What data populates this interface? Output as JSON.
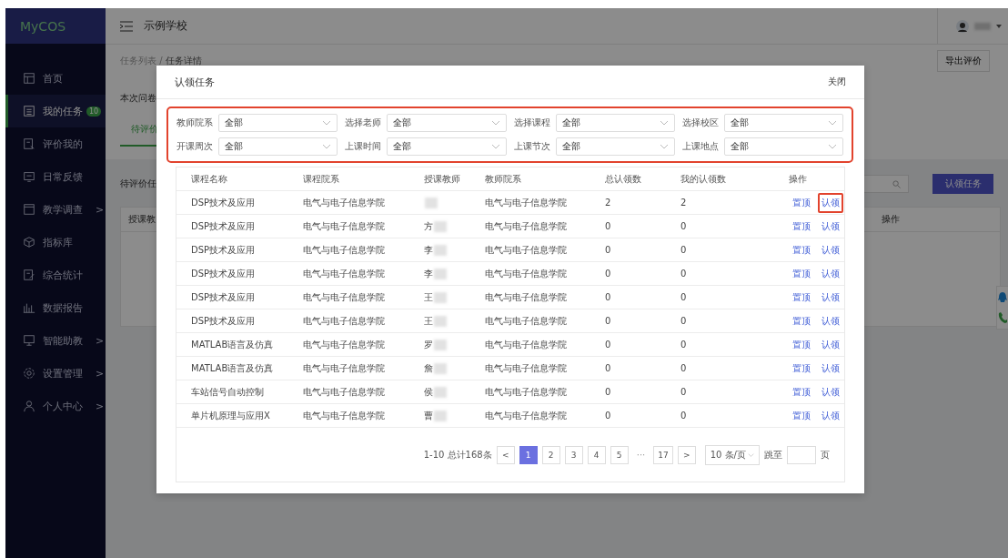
{
  "sidebar": {
    "logo": "MyCOS",
    "items": [
      {
        "label": "首页",
        "selected": false
      },
      {
        "label": "我的任务",
        "selected": true,
        "badge": "10"
      },
      {
        "label": "评价我的",
        "selected": false
      },
      {
        "label": "日常反馈",
        "selected": false
      },
      {
        "label": "教学调查",
        "selected": false,
        "arrow": ">"
      },
      {
        "label": "指标库",
        "selected": false
      },
      {
        "label": "综合统计",
        "selected": false
      },
      {
        "label": "数据报告",
        "selected": false
      },
      {
        "label": "智能助教",
        "selected": false,
        "arrow": ">"
      },
      {
        "label": "设置管理",
        "selected": false,
        "arrow": ">"
      },
      {
        "label": "个人中心",
        "selected": false,
        "arrow": ">"
      }
    ]
  },
  "header": {
    "school": "示例学校"
  },
  "page": {
    "breadcrumb": {
      "parent": "任务列表 /",
      "current": "任务详情"
    },
    "export_button": "导出评价",
    "survey_text": "本次问卷",
    "tabs": [
      {
        "label": "待评价",
        "selected": true
      }
    ],
    "section_title": "待评价任",
    "claim_button": "认领任务",
    "table_columns": [
      "授课教",
      "操作"
    ]
  },
  "modal": {
    "title": "认领任务",
    "close": "关闭",
    "filters": {
      "highlighted": true,
      "items": [
        {
          "label": "教师院系",
          "value": "全部"
        },
        {
          "label": "选择老师",
          "value": "全部"
        },
        {
          "label": "选择课程",
          "value": "全部"
        },
        {
          "label": "选择校区",
          "value": "全部"
        },
        {
          "label": "开课周次",
          "value": "全部"
        },
        {
          "label": "上课时间",
          "value": "全部"
        },
        {
          "label": "上课节次",
          "value": "全部"
        },
        {
          "label": "上课地点",
          "value": "全部"
        }
      ]
    },
    "table": {
      "columns": [
        "课程名称",
        "课程院系",
        "授课教师",
        "教师院系",
        "总认领数",
        "我的认领数",
        "操作"
      ],
      "rows": [
        {
          "course": "DSP技术及应用",
          "course_dept": "电气与电子信息学院",
          "teacher": "",
          "teacher_dept": "电气与电子信息学院",
          "total": "2",
          "mine": "2",
          "pin": "置顶",
          "claim": "认领",
          "claim_highlighted": true
        },
        {
          "course": "DSP技术及应用",
          "course_dept": "电气与电子信息学院",
          "teacher": "方",
          "teacher_dept": "电气与电子信息学院",
          "total": "0",
          "mine": "0",
          "pin": "置顶",
          "claim": "认领",
          "claim_highlighted": false
        },
        {
          "course": "DSP技术及应用",
          "course_dept": "电气与电子信息学院",
          "teacher": "李",
          "teacher_dept": "电气与电子信息学院",
          "total": "0",
          "mine": "0",
          "pin": "置顶",
          "claim": "认领",
          "claim_highlighted": false
        },
        {
          "course": "DSP技术及应用",
          "course_dept": "电气与电子信息学院",
          "teacher": "李",
          "teacher_dept": "电气与电子信息学院",
          "total": "0",
          "mine": "0",
          "pin": "置顶",
          "claim": "认领",
          "claim_highlighted": false
        },
        {
          "course": "DSP技术及应用",
          "course_dept": "电气与电子信息学院",
          "teacher": "王",
          "teacher_dept": "电气与电子信息学院",
          "total": "0",
          "mine": "0",
          "pin": "置顶",
          "claim": "认领",
          "claim_highlighted": false
        },
        {
          "course": "DSP技术及应用",
          "course_dept": "电气与电子信息学院",
          "teacher": "王",
          "teacher_dept": "电气与电子信息学院",
          "total": "0",
          "mine": "0",
          "pin": "置顶",
          "claim": "认领",
          "claim_highlighted": false
        },
        {
          "course": "MATLAB语言及仿真",
          "course_dept": "电气与电子信息学院",
          "teacher": "罗",
          "teacher_dept": "电气与电子信息学院",
          "total": "0",
          "mine": "0",
          "pin": "置顶",
          "claim": "认领",
          "claim_highlighted": false
        },
        {
          "course": "MATLAB语言及仿真",
          "course_dept": "电气与电子信息学院",
          "teacher": "詹",
          "teacher_dept": "电气与电子信息学院",
          "total": "0",
          "mine": "0",
          "pin": "置顶",
          "claim": "认领",
          "claim_highlighted": false
        },
        {
          "course": "车站信号自动控制",
          "course_dept": "电气与电子信息学院",
          "teacher": "侯",
          "teacher_dept": "电气与电子信息学院",
          "total": "0",
          "mine": "0",
          "pin": "置顶",
          "claim": "认领",
          "claim_highlighted": false
        },
        {
          "course": "单片机原理与应用X",
          "course_dept": "电气与电子信息学院",
          "teacher": "曹",
          "teacher_dept": "电气与电子信息学院",
          "total": "0",
          "mine": "0",
          "pin": "置顶",
          "claim": "认领",
          "claim_highlighted": false
        }
      ]
    },
    "pagination": {
      "summary": "1-10 总计168条",
      "prev": "<",
      "pages": [
        {
          "label": "1",
          "selected": true
        },
        {
          "label": "2",
          "selected": false
        },
        {
          "label": "3",
          "selected": false
        },
        {
          "label": "4",
          "selected": false
        },
        {
          "label": "5",
          "selected": false
        }
      ],
      "ellipsis": "···",
      "last": "17",
      "next": ">",
      "page_size": "10 条/页",
      "jump_label": "跳至",
      "jump_unit": "页"
    }
  }
}
